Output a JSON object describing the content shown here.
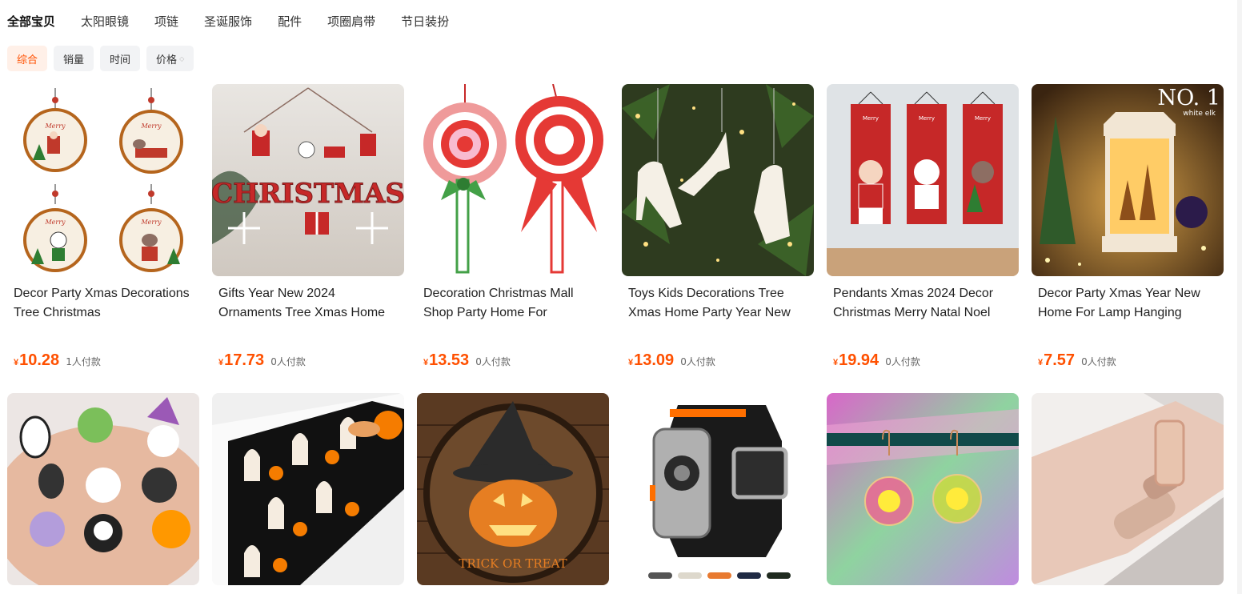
{
  "categories": [
    "全部宝贝",
    "太阳眼镜",
    "项链",
    "圣诞服饰",
    "配件",
    "项圈肩带",
    "节日装扮"
  ],
  "sort": {
    "comprehensive": "综合",
    "sales": "销量",
    "time": "时间",
    "price": "价格"
  },
  "currency_symbol": "¥",
  "products": [
    {
      "title": "Decor Party Xmas Decorations Tree Christmas",
      "price": "10.28",
      "sold": "1人付款"
    },
    {
      "title": "Gifts Year New 2024 Ornaments Tree Xmas Home",
      "price": "17.73",
      "sold": "0人付款"
    },
    {
      "title": "Decoration Christmas Mall Shop Party Home For",
      "price": "13.53",
      "sold": "0人付款"
    },
    {
      "title": "Toys Kids Decorations Tree Xmas Home Party Year New",
      "price": "13.09",
      "sold": "0人付款"
    },
    {
      "title": "Pendants Xmas 2024 Decor Christmas Merry Natal Noel",
      "price": "19.94",
      "sold": "0人付款"
    },
    {
      "title": "Decor Party Xmas Year New Home For Lamp Hanging",
      "price": "7.57",
      "sold": "0人付款"
    }
  ],
  "image_text": {
    "christmas_sign": "CHRISTMAS",
    "no1": "NO. 1",
    "white_elk": "white elk",
    "trick_or_treat": "TRICK OR TREAT",
    "merry": "Merry",
    "christmas": "Christmas"
  },
  "colors": {
    "accent": "#ff5000",
    "active_tab_bg": "#fff0e8",
    "tab_bg": "#f2f3f5"
  }
}
